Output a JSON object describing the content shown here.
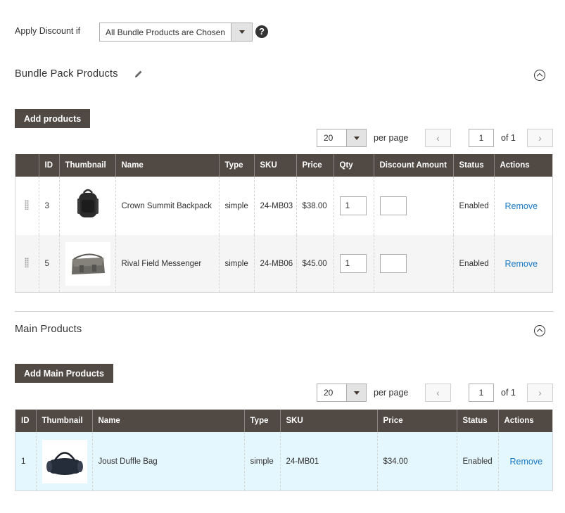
{
  "apply_discount": {
    "label": "Apply Discount if",
    "selected": "All Bundle Products are Chosen",
    "help_glyph": "?"
  },
  "bundle_section": {
    "title": "Bundle Pack Products",
    "add_button": "Add products",
    "pager": {
      "per_page_value": "20",
      "per_page_label": "per page",
      "page": "1",
      "of_label": "of 1",
      "prev": "‹",
      "next": "›"
    },
    "columns": [
      "",
      "ID",
      "Thumbnail",
      "Name",
      "Type",
      "SKU",
      "Price",
      "Qty",
      "Discount Amount",
      "Status",
      "Actions"
    ],
    "rows": [
      {
        "id": "3",
        "thumb": "backpack",
        "name": "Crown Summit Backpack",
        "type": "simple",
        "sku": "24-MB03",
        "price": "$38.00",
        "qty": "1",
        "discount": "",
        "status": "Enabled",
        "action": "Remove"
      },
      {
        "id": "5",
        "thumb": "messenger-bag",
        "name": "Rival Field Messenger",
        "type": "simple",
        "sku": "24-MB06",
        "price": "$45.00",
        "qty": "1",
        "discount": "",
        "status": "Enabled",
        "action": "Remove"
      }
    ]
  },
  "main_section": {
    "title": "Main Products",
    "add_button": "Add Main Products",
    "pager": {
      "per_page_value": "20",
      "per_page_label": "per page",
      "page": "1",
      "of_label": "of 1",
      "prev": "‹",
      "next": "›"
    },
    "columns": [
      "ID",
      "Thumbnail",
      "Name",
      "Type",
      "SKU",
      "Price",
      "Status",
      "Actions"
    ],
    "rows": [
      {
        "id": "1",
        "thumb": "duffle-bag",
        "name": "Joust Duffle Bag",
        "type": "simple",
        "sku": "24-MB01",
        "price": "$34.00",
        "status": "Enabled",
        "action": "Remove"
      }
    ]
  },
  "colors": {
    "header_bg": "#514943",
    "link": "#1979c3",
    "selected_row": "#e5f7fe"
  }
}
